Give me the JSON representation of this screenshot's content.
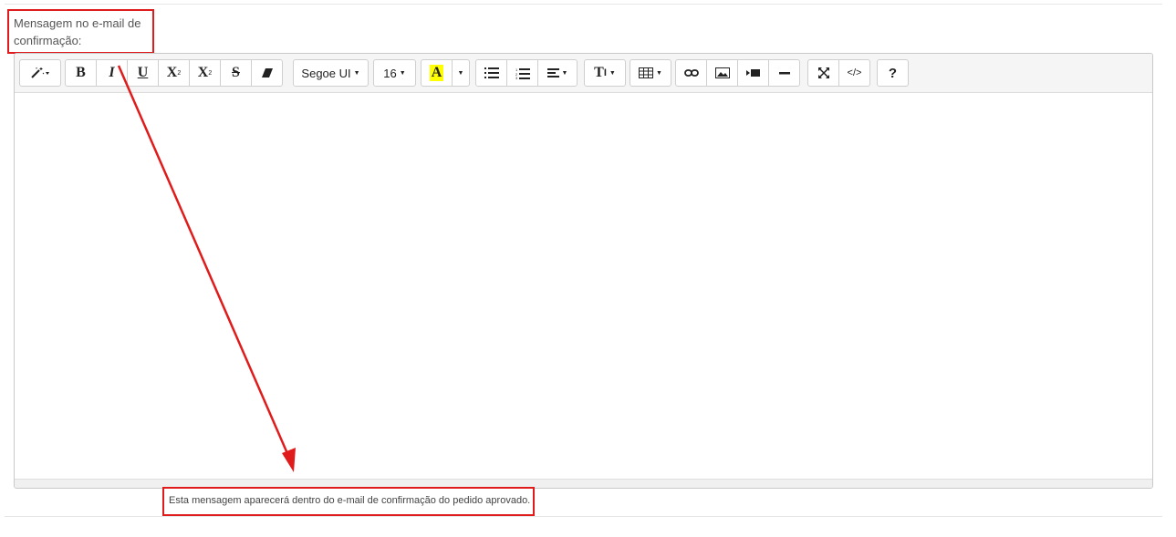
{
  "field": {
    "label": "Mensagem no e-mail de confirmação:",
    "help": "Esta mensagem aparecerá dentro do e-mail de confirmação do pedido aprovado."
  },
  "toolbar": {
    "bold": "B",
    "italic": "I",
    "underline": "U",
    "superscript": "X",
    "subscript": "X",
    "strikethrough": "S",
    "font_name": "Segoe UI",
    "font_size": "16",
    "color_letter": "A",
    "style": "T",
    "code_view": "</>",
    "help": "?"
  },
  "colors": {
    "annotation": "#e01b1b",
    "highlight": "#ffff00"
  }
}
